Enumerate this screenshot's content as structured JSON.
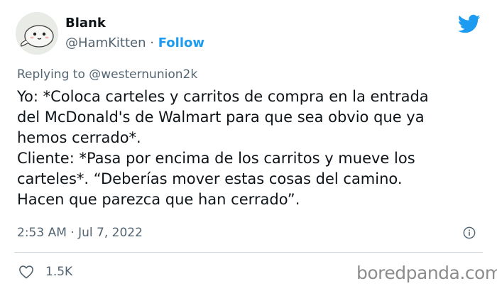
{
  "author": {
    "name": "Blank",
    "handle": "@HamKitten",
    "separator": "·",
    "follow_label": "Follow"
  },
  "reply": {
    "prefix": "Replying to",
    "mention": "@westernunion2k"
  },
  "tweet": {
    "text": "Yo: *Coloca carteles y carritos de compra en la entrada\ndel McDonald's de Walmart para que sea obvio que ya\nhemos cerrado*.\nCliente: *Pasa por encima de los carritos y mueve los\ncarteles*. “Deberías mover estas cosas del camino.\nHacen que parezca que han cerrado”.",
    "timestamp": "2:53 AM · Jul 7, 2022",
    "likes": "1.5K"
  },
  "icons": {
    "brand": "twitter-bird-icon",
    "info": "info-icon",
    "like": "heart-icon",
    "avatar": "cartoon-seal-avatar"
  },
  "colors": {
    "accent": "#1d9bf0",
    "secondary_text": "#536471",
    "divider": "#cfd9de"
  },
  "watermark": "boredpanda.com"
}
